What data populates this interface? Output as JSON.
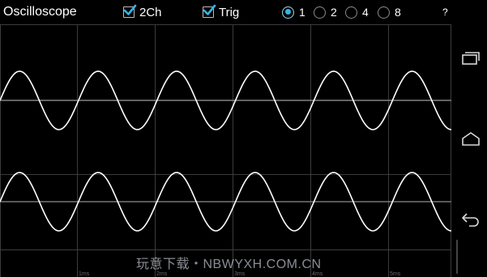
{
  "app": {
    "title": "Oscilloscope"
  },
  "toolbar": {
    "two_channel": {
      "label": "2Ch",
      "checked": true
    },
    "trigger": {
      "label": "Trig",
      "checked": true
    },
    "scale_options": [
      {
        "label": "1",
        "selected": true
      },
      {
        "label": "2",
        "selected": false
      },
      {
        "label": "4",
        "selected": false
      },
      {
        "label": "8",
        "selected": false
      }
    ],
    "help_label": "?"
  },
  "scope": {
    "time_labels": [
      "",
      "1ms",
      "2ms",
      "3ms",
      "4ms",
      "5ms"
    ],
    "channels": [
      {
        "name": "",
        "waveform": "sine",
        "cycles_visible": 5.75
      },
      {
        "name": "",
        "waveform": "sine",
        "cycles_visible": 5.75
      }
    ],
    "colors": {
      "trace": "#ffffff",
      "grid": "#3c3c3c",
      "baseline": "#8c8c8c",
      "background": "#000000"
    }
  },
  "watermark": {
    "text": "玩意下载・NBWYXH.COM.CN"
  },
  "navbar": {
    "icons": [
      "recent-apps-icon",
      "home-icon",
      "back-icon"
    ]
  },
  "theme": {
    "accent": "#33b5e5"
  }
}
